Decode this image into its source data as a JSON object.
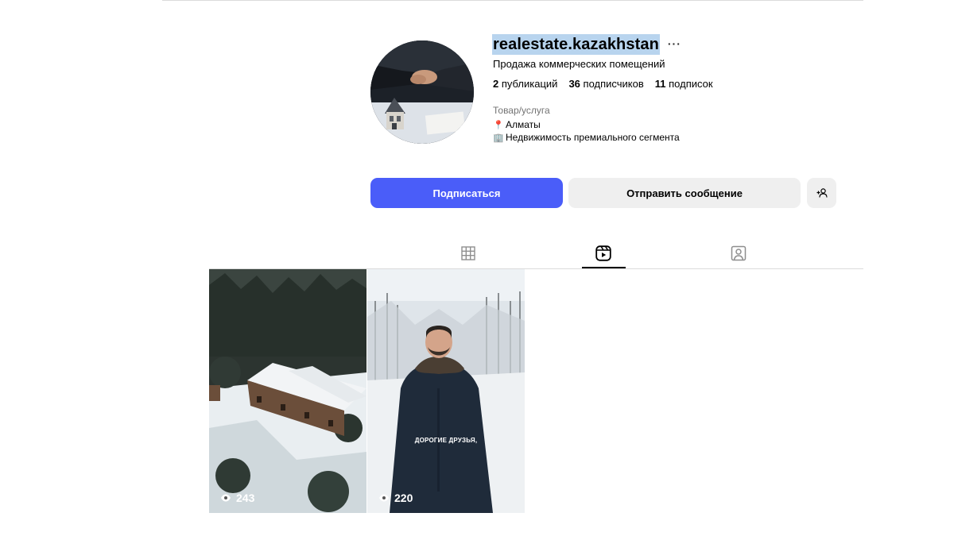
{
  "profile": {
    "username": "realestate.kazakhstan",
    "more_label": "···",
    "bio_title": "Продажа коммерческих помещений",
    "stats": [
      {
        "value": "2",
        "label": "публикаций"
      },
      {
        "value": "36",
        "label": "подписчиков"
      },
      {
        "value": "11",
        "label": "подписок"
      }
    ],
    "category": "Товар/услуга",
    "location_emoji": "📍",
    "location": "Алматы",
    "description_emoji": "🏢",
    "description": "Недвижимость премиального сегмента"
  },
  "actions": {
    "follow_label": "Подписаться",
    "message_label": "Отправить сообщение"
  },
  "tabs": [
    "grid-icon",
    "reels-icon",
    "tagged-icon"
  ],
  "active_tab": "reels",
  "posts": [
    {
      "views": "243",
      "caption": ""
    },
    {
      "views": "220",
      "caption": "ДОРОГИЕ ДРУЗЬЯ,"
    }
  ],
  "colors": {
    "follow_button": "#4a5df9",
    "secondary_button": "#efefef",
    "username_highlight": "#b8d4ee",
    "muted_text": "#737373"
  }
}
